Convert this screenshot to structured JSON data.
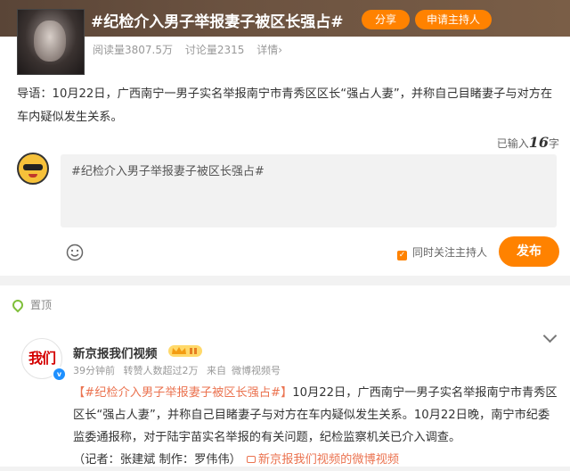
{
  "topic": {
    "title": "#纪检介入男子举报妻子被区长强占#",
    "share_label": "分享",
    "host_label": "申请主持人",
    "reads": "阅读量3807.5万",
    "discussions": "讨论量2315",
    "details": "详情›"
  },
  "intro": "导语：10月22日，广西南宁一男子实名举报南宁市青秀区区长“强占人妻”，并称自己目睹妻子与对方在车内疑似发生关系。",
  "composer": {
    "counter_prefix": "已输入",
    "counter_num": "16",
    "counter_suffix": "字",
    "text": "#纪检介入男子举报妻子被区长强占#",
    "follow_label": "同时关注主持人",
    "post_label": "发布"
  },
  "feed": {
    "pinned_label": "置顶",
    "post": {
      "avatar_text": "我们",
      "author": "新京报我们视频",
      "time": "39分钟前",
      "reposts": "转赞人数超过2万",
      "source_prefix": "来自",
      "source": "微博视频号",
      "hashtag": "【#纪检介入男子举报妻子被区长强占#】",
      "text": "10月22日，广西南宁一男子实名举报南宁市青秀区区长“强占人妻”，并称自己目睹妻子与对方在车内疑似发生关系。10月22日晚，南宁市纪委监委通报称，对于陆宇苗实名举报的有关问题，纪检监察机关已介入调查。",
      "credits": "（记者：张建斌 制作：罗伟伟）",
      "video_link": "新京报我们视频的微博视频"
    }
  },
  "colors": {
    "accent": "#ff8200",
    "link": "#eb7350",
    "verified": "#1e90ff"
  }
}
